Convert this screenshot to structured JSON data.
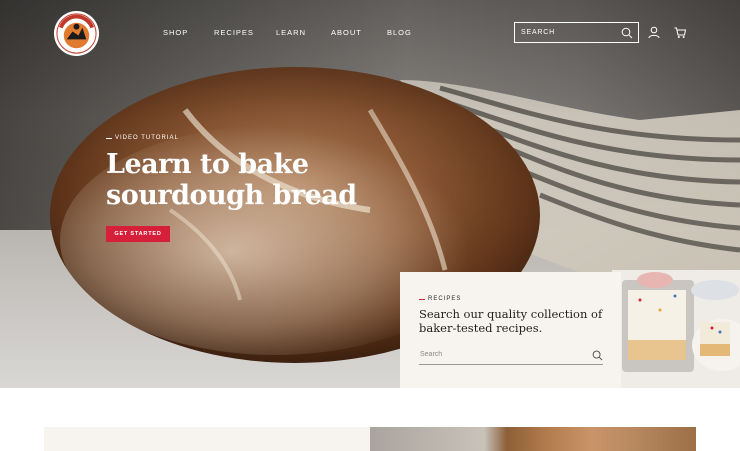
{
  "header": {
    "logo_text": "KING ARTHUR FLOUR",
    "nav": [
      "SHOP",
      "RECIPES",
      "LEARN",
      "ABOUT",
      "BLOG"
    ],
    "search_label": "SEARCH",
    "icons": [
      "search-icon",
      "account-icon",
      "cart-icon"
    ]
  },
  "hero": {
    "eyebrow": "VIDEO TUTORIAL",
    "title_line1": "Learn to bake",
    "title_line2": "sourdough bread",
    "cta": "GET STARTED"
  },
  "recipe_card": {
    "eyebrow": "RECIPES",
    "title": "Search our quality collection of baker-tested recipes.",
    "search_placeholder": "Search"
  },
  "colors": {
    "accent": "#d6203a",
    "card_bg": "#f7f4ef",
    "text_dark": "#1f1f1f"
  }
}
